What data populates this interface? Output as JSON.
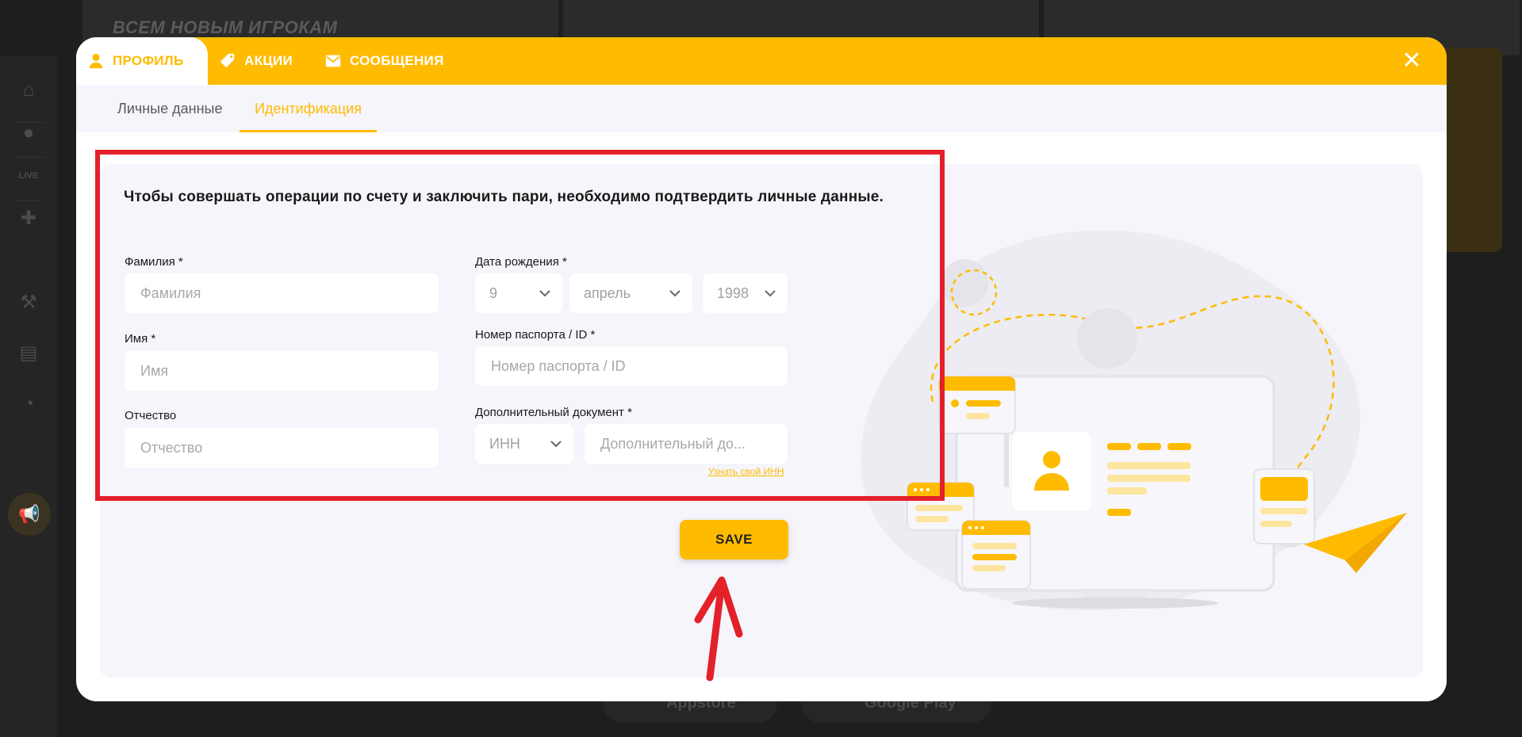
{
  "background": {
    "banner_text": "ВСЕМ НОВЫМ ИГРОКАМ",
    "store_buttons": [
      "Appstore",
      "Google Play"
    ]
  },
  "modal": {
    "tabs": [
      {
        "label": "ПРОФИЛЬ",
        "icon": "user-icon",
        "active": true
      },
      {
        "label": "АКЦИИ",
        "icon": "tag-icon",
        "active": false
      },
      {
        "label": "СООБЩЕНИЯ",
        "icon": "envelope-icon",
        "active": false
      }
    ],
    "close_icon": "close-icon",
    "subtabs": [
      {
        "label": "Личные данные",
        "active": false
      },
      {
        "label": "Идентификация",
        "active": true
      }
    ],
    "intro_text": "Чтобы совершать операции по счету и заключить пари, необходимо подтвердить личные данные.",
    "form": {
      "surname": {
        "label": "Фамилия *",
        "placeholder": "Фамилия",
        "value": ""
      },
      "first_name": {
        "label": "Имя *",
        "placeholder": "Имя",
        "value": ""
      },
      "patronymic": {
        "label": "Отчество",
        "placeholder": "Отчество",
        "value": ""
      },
      "birth_date": {
        "label": "Дата рождения *",
        "day": "9",
        "month": "апрель",
        "year": "1998"
      },
      "passport": {
        "label": "Номер паспорта / ID *",
        "placeholder": "Номер паспорта / ID",
        "value": ""
      },
      "extra_doc": {
        "label": "Дополнительный документ *",
        "type": "ИНН",
        "placeholder": "Дополнительный до...",
        "link": "Узнать свой ИНН"
      }
    },
    "save_label": "SAVE"
  },
  "colors": {
    "accent": "#ffbb00",
    "annotation": "#e4202a",
    "panel": "#f5f5fb"
  }
}
